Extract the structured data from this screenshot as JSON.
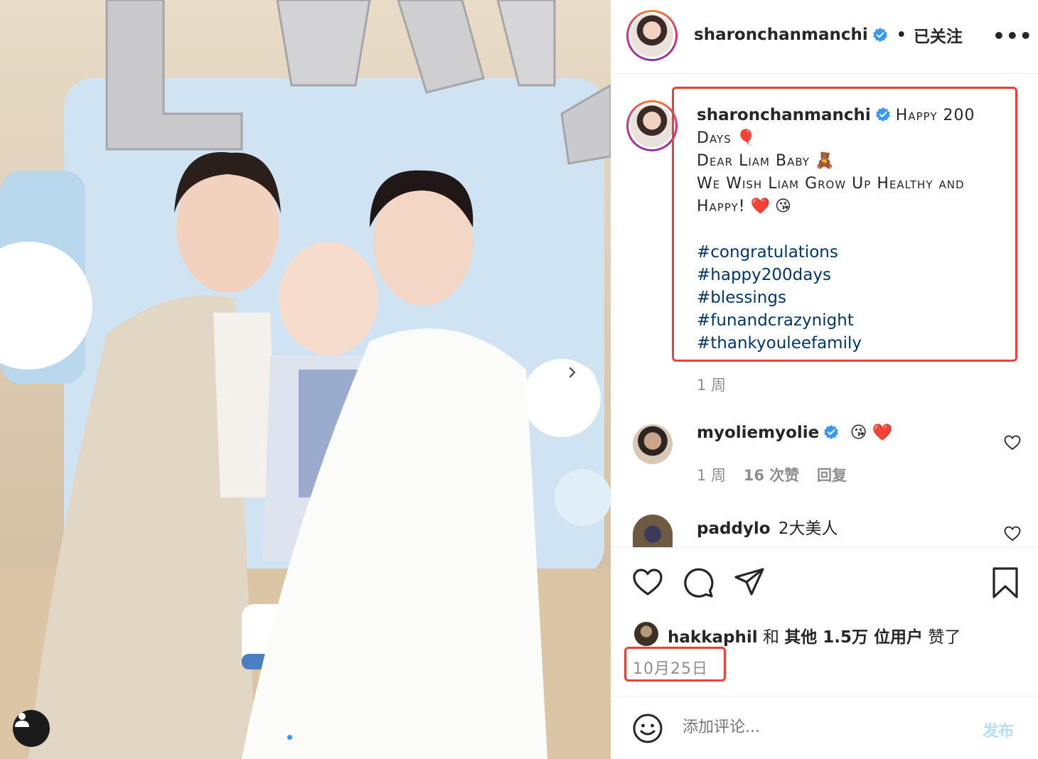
{
  "post": {
    "author": "sharonchanmanchi",
    "follow_status": "已关注",
    "separator": "•",
    "more_label": "•••"
  },
  "caption": {
    "author": "sharonchanmanchi",
    "line1": "Happy 200",
    "line2": "Days",
    "emoji_balloon": "🎈",
    "line3": "Dear Liam Baby",
    "emoji_bear": "🧸",
    "line4": "We Wish Liam Grow Up Healthy and",
    "line5": "Happy!",
    "emoji_heart": "❤️",
    "emoji_kiss": "😘",
    "hashtags": [
      "#congratulations",
      "#happy200days",
      "#blessings",
      "#funandcrazynight",
      "#thankyouleefamily"
    ],
    "time": "1 周"
  },
  "comments": [
    {
      "user": "myoliemyolie",
      "verified": true,
      "text": "😘 ❤️",
      "time": "1 周",
      "likes": "16 次赞",
      "reply": "回复"
    },
    {
      "user": "paddylo",
      "verified": false,
      "text": "2大美人"
    }
  ],
  "likes": {
    "first_user": "hakkaphil",
    "connector": "和",
    "others": "其他 1.5万 位用户",
    "suffix": "赞了"
  },
  "date": "10月25日",
  "comment_box": {
    "placeholder": "添加评论...",
    "post_label": "发布"
  },
  "colors": {
    "hashtag": "#00376b",
    "verified": "#3897f0",
    "highlight_box": "#e8423a",
    "muted": "#8e8e8e",
    "post_disabled": "#b2dffc"
  },
  "icons": [
    "verified-badge-icon",
    "more-options-icon",
    "heart-icon",
    "comment-icon",
    "share-icon",
    "bookmark-icon",
    "emoji-icon",
    "next-arrow-icon",
    "user-tag-icon"
  ]
}
